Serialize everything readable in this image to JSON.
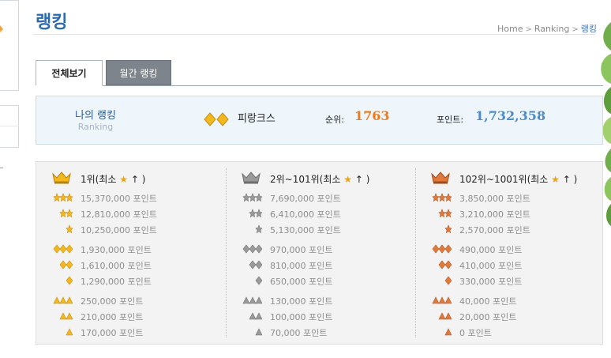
{
  "page": {
    "title": "랭킹",
    "breadcrumb": [
      "Home",
      "Ranking",
      "랭킹"
    ]
  },
  "tabs": [
    {
      "label": "전체보기",
      "active": true
    },
    {
      "label": "월간 랭킹",
      "active": false
    }
  ],
  "my_ranking": {
    "title": "나의 랭킹",
    "subtitle": "Ranking",
    "grade_icon": "gold-double-diamond-icon",
    "name": "피랑크스",
    "rank_label": "순위:",
    "rank_value": "1763",
    "points_label": "포인트:",
    "points_value": "1,732,358"
  },
  "grades": [
    {
      "tier": "gold",
      "title": "1위(최소",
      "title_suffix": "↑ )",
      "rows": [
        "15,370,000 포인트",
        "12,810,000 포인트",
        "10,250,000 포인트",
        "1,930,000 포인트",
        "1,610,000 포인트",
        "1,290,000 포인트",
        "250,000 포인트",
        "210,000 포인트",
        "170,000 포인트"
      ]
    },
    {
      "tier": "silver",
      "title": "2위~101위(최소",
      "title_suffix": "↑ )",
      "rows": [
        "7,690,000 포인트",
        "6,410,000 포인트",
        "5,130,000 포인트",
        "970,000 포인트",
        "810,000 포인트",
        "650,000 포인트",
        "130,000 포인트",
        "100,000 포인트",
        "70,000 포인트"
      ]
    },
    {
      "tier": "bronze",
      "title": "102위~1001위(최소",
      "title_suffix": "↑ )",
      "rows": [
        "3,850,000 포인트",
        "3,210,000 포인트",
        "2,570,000 포인트",
        "490,000 포인트",
        "410,000 포인트",
        "330,000 포인트",
        "40,000 포인트",
        "20,000 포인트",
        "0 포인트"
      ]
    }
  ],
  "colors": {
    "title": "#2d6aad",
    "rank_value": "#f07a1a",
    "points_value": "#4d8ac8",
    "gold": "#f2b81d",
    "silver": "#9a9a9a",
    "bronze": "#e07a3c"
  }
}
